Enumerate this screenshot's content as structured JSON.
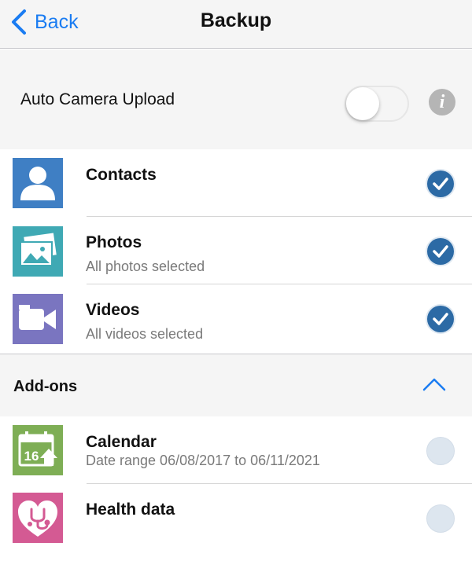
{
  "nav": {
    "back_label": "Back",
    "title": "Backup"
  },
  "auto_upload": {
    "label": "Auto Camera Upload",
    "enabled": false,
    "info_glyph": "i"
  },
  "backup_items": [
    {
      "title": "Contacts",
      "subtitle": "",
      "icon": "contacts-icon",
      "icon_color": "#3f7fc4",
      "checked": true
    },
    {
      "title": "Photos",
      "subtitle": "All photos selected",
      "icon": "photos-icon",
      "icon_color": "#3fa9b4",
      "checked": true
    },
    {
      "title": "Videos",
      "subtitle": "All videos selected",
      "icon": "videos-icon",
      "icon_color": "#7a75c0",
      "checked": true
    }
  ],
  "addons": {
    "label": "Add-ons",
    "expanded": true,
    "items": [
      {
        "title": "Calendar",
        "subtitle": "Date range 06/08/2017 to 06/11/2021",
        "icon": "calendar-icon",
        "icon_color": "#7eae55",
        "calendar_day": "16",
        "checked": false
      },
      {
        "title": "Health data",
        "subtitle": "",
        "icon": "health-icon",
        "icon_color": "#d45a93",
        "checked": false
      }
    ]
  },
  "colors": {
    "accent": "#1a7cf2",
    "check": "#2c6aa5",
    "subtitle": "#7a7a7a",
    "section_bg": "#f5f5f5"
  }
}
